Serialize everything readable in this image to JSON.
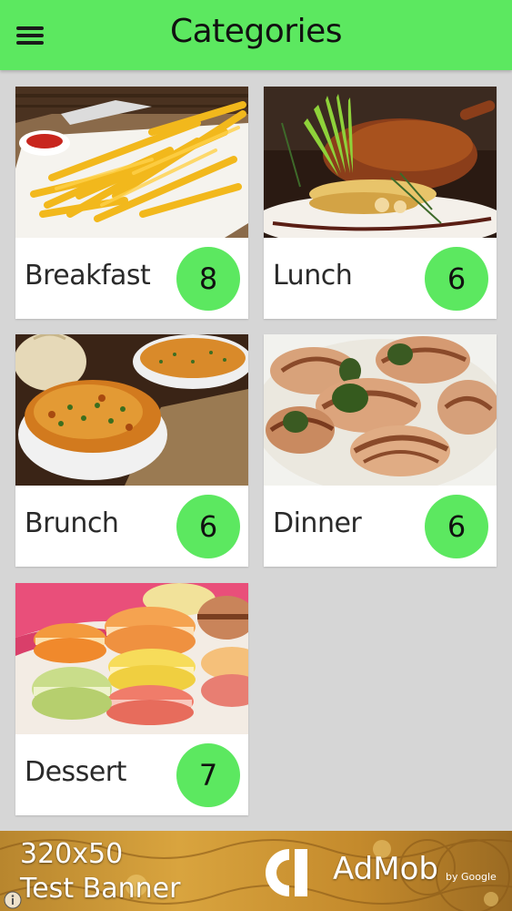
{
  "app_bar": {
    "title": "Categories",
    "menu_icon": "hamburger-menu-icon",
    "color": "#5ce860"
  },
  "categories": [
    {
      "label": "Breakfast",
      "count": "8",
      "image": "french-fries-photo"
    },
    {
      "label": "Lunch",
      "count": "6",
      "image": "roast-duck-plate-photo"
    },
    {
      "label": "Brunch",
      "count": "6",
      "image": "cheese-gratin-bowls-photo"
    },
    {
      "label": "Dinner",
      "count": "6",
      "image": "escargot-plate-photo"
    },
    {
      "label": "Dessert",
      "count": "7",
      "image": "macarons-photo"
    }
  ],
  "badge_color": "#5ce860",
  "ad": {
    "line1": "320x50",
    "line2": "Test Banner",
    "brand": "AdMob",
    "by": "by Google",
    "info_icon": "info-icon"
  }
}
